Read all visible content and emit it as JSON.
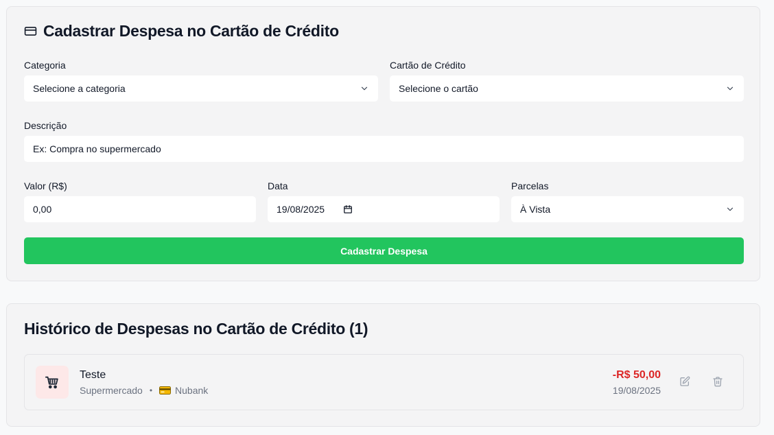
{
  "form": {
    "title": "Cadastrar Despesa no Cartão de Crédito",
    "title_icon": "credit-card-icon",
    "category": {
      "label": "Categoria",
      "value": "Selecione a categoria"
    },
    "card": {
      "label": "Cartão de Crédito",
      "value": "Selecione o cartão"
    },
    "description": {
      "label": "Descrição",
      "placeholder": "Ex: Compra no supermercado"
    },
    "amount": {
      "label": "Valor (R$)",
      "placeholder": "0,00"
    },
    "date": {
      "label": "Data",
      "value": "19/08/2025"
    },
    "installments": {
      "label": "Parcelas",
      "value": "À Vista"
    },
    "submit_label": "Cadastrar Despesa",
    "submit_color": "#22c55e"
  },
  "history": {
    "title": "Histórico de Despesas no Cartão de Crédito",
    "count": "(1)",
    "items": [
      {
        "icon": "shopping-cart-icon",
        "name": "Teste",
        "category": "Supermercado",
        "separator": "•",
        "card_icon": "credit-card-icon",
        "card": "Nubank",
        "amount": "-R$ 50,00",
        "date": "19/08/2025"
      }
    ],
    "amount_color": "#dc2626"
  }
}
